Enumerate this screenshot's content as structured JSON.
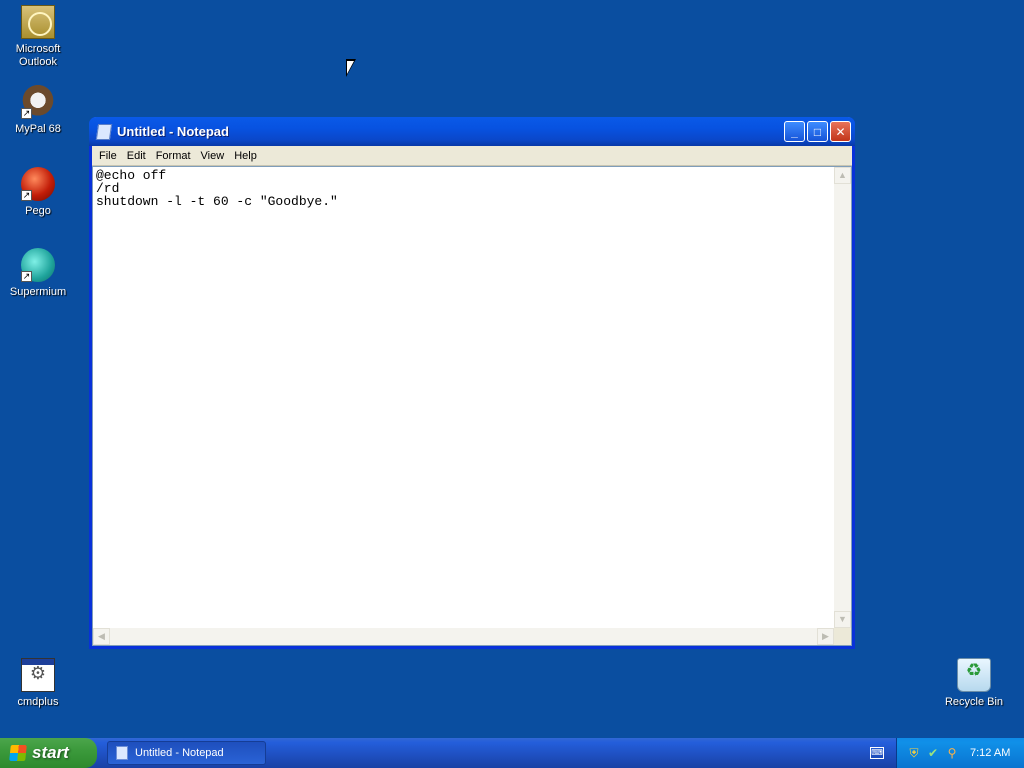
{
  "desktop": {
    "icons": [
      {
        "label": "Microsoft Outlook",
        "icon": "outlook-icon"
      },
      {
        "label": "MyPal 68",
        "icon": "mypal-icon"
      },
      {
        "label": "Pego",
        "icon": "pego-icon"
      },
      {
        "label": "Supermium",
        "icon": "supermium-icon"
      },
      {
        "label": "cmdplus",
        "icon": "cmdplus-icon"
      },
      {
        "label": "Recycle Bin",
        "icon": "recycle-bin-icon"
      }
    ]
  },
  "window": {
    "title": "Untitled - Notepad",
    "menu": [
      "File",
      "Edit",
      "Format",
      "View",
      "Help"
    ],
    "content": "@echo off\n/rd\nshutdown -l -t 60 -c \"Goodbye.\""
  },
  "taskbar": {
    "start_label": "start",
    "task_label": "Untitled - Notepad",
    "clock": "7:12 AM"
  },
  "colors": {
    "desktop_bg": "#0a4ea0",
    "titlebar": "#0a5ae8",
    "taskbar": "#245edb",
    "start": "#3c9a3c"
  }
}
